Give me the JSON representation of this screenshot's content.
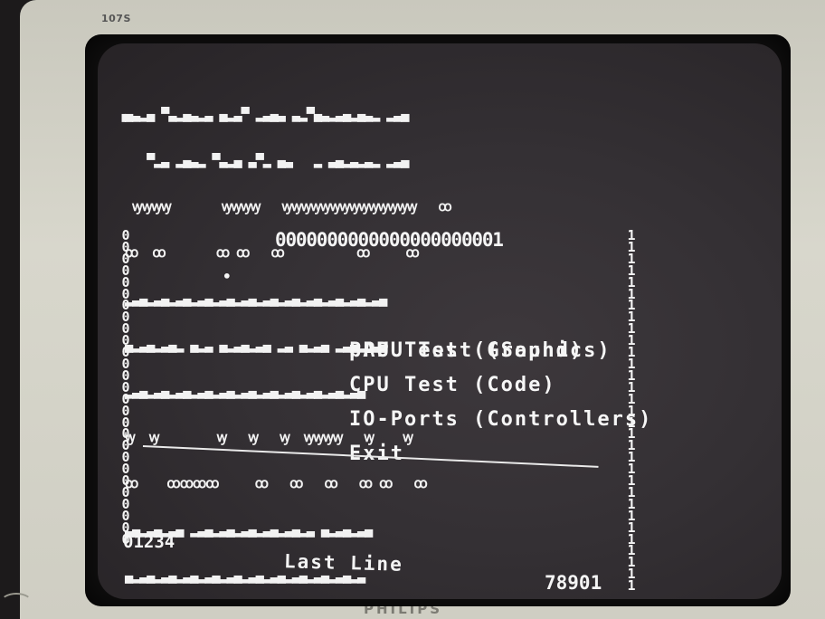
{
  "monitor": {
    "model_badge": "107S",
    "brand": "PHILIPS"
  },
  "screen": {
    "garbage_rows": [
      "▗▄▃▂▄ ▀▃▂▄▃▂▃ ▄▂▃▀ ▂▃▄▃ ▃▂▀▄▃▂▃▄▂▄▃▂ ▂▃▄",
      "    ▀▂▃ ▂▄▃▂ ▀▃▂▄ ▃▀▂ ▄▃   ▂ ▃▄▂▃▂▃▂ ▂▃▄",
      "  ꝡꝡꝡꝡ       ꝡꝡꝡꝡ   ꝡꝡꝡꝡꝡꝡꝡꝡꝡꝡꝡꝡꝡꝡ   ꝏ",
      " ꝏ  ꝏ       ꝏ ꝏ   ꝏ          ꝏ     ꝏ",
      " ▂▃▄▂▃▄▂▃▄▂▃▄▂▃▄▂▃▄▂▃▄▂▃▄▂▃▄▂▃▄▂▃▄▂▃▄",
      " ▄▂▃▄▂▃▄▂ ▄▂▃ ▄▂▃▄▂▃▄ ▂▃ ▄▂▃▄ ▂▃▄▂ ▃▄",
      " ▂▃▄▂▃▄▂▃▄▂▃▄▂▃▄▂▃▄▂▃▄▂▃▄▂▃▄▂▃▄▂▃▄",
      " ꝡ  ꝡ        ꝡ   ꝡ   ꝡ  ꝡꝡꝡꝡ   ꝡ    ꝡ",
      " ꝏ    ꝏꝏꝏꝏ     ꝏ   ꝏ   ꝏ   ꝏ ꝏ   ꝏ",
      " ▃▄▂▃▄▂▃▄ ▂▃▄▂▃▄▂▃▄▂▃▄▂▃▄▂▃ ▄▂▃▄▂▃▄",
      " ▄▂▃▄▂▃▄▂▃▄▂▃▄▂▃▄▂▃▄▂▃▄▂▃▄▂▃▄▂▃▄▂▃"
    ],
    "left_column_digits": "000000000000000000000000000",
    "right_column_digits": "1111111111111111111111111111111",
    "top_zeros": "0000000000000000000001",
    "menu": {
      "cursor": "•",
      "items": [
        "PPU Test (Graphics)",
        "pAPU Test (Sound)",
        "CPU Test (Code)",
        "IO-Ports (Controllers)",
        "Exit"
      ]
    },
    "counter_left": "01234",
    "last_line": "Last Line",
    "counter_right": "78901"
  }
}
